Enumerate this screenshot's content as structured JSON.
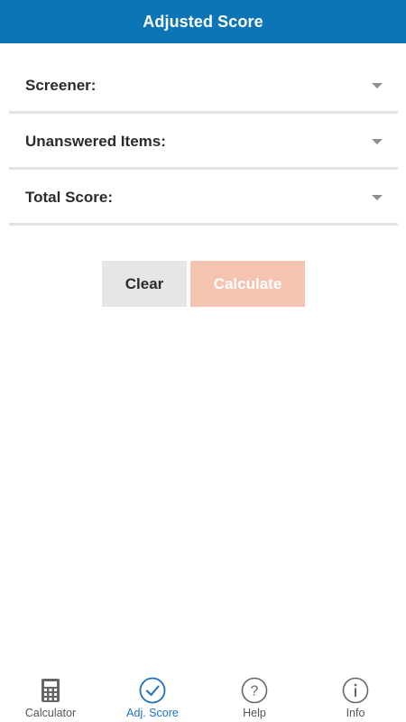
{
  "header": {
    "title": "Adjusted Score"
  },
  "form": {
    "fields": [
      {
        "label": "Screener:"
      },
      {
        "label": "Unanswered Items:"
      },
      {
        "label": "Total Score:"
      }
    ]
  },
  "actions": {
    "clear_label": "Clear",
    "calculate_label": "Calculate"
  },
  "tabbar": {
    "tabs": [
      {
        "label": "Calculator",
        "icon": "calculator-icon"
      },
      {
        "label": "Adj. Score",
        "icon": "check-circle-icon",
        "active": true
      },
      {
        "label": "Help",
        "icon": "question-circle-icon"
      },
      {
        "label": "Info",
        "icon": "info-circle-icon"
      }
    ]
  },
  "colors": {
    "header_bg": "#0b75b8",
    "active_tab": "#1a6fbf",
    "calculate_disabled_bg": "#f5c4b0",
    "clear_bg": "#e6e6e6"
  }
}
